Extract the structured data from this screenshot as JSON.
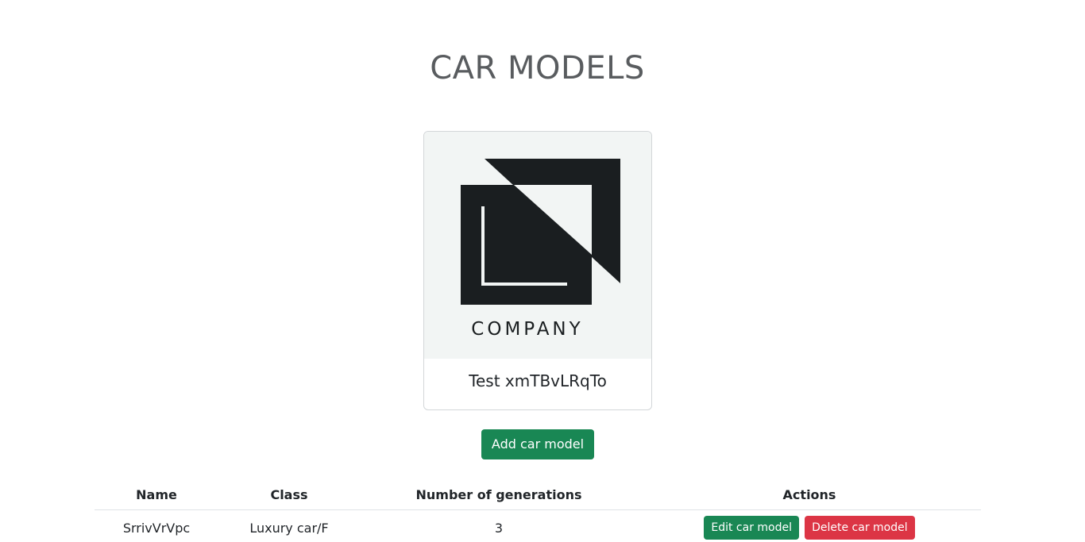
{
  "page": {
    "title": "CAR MODELS"
  },
  "brand": {
    "logo_text": "COMPANY",
    "name": "Test xmTBvLRqTo"
  },
  "actions": {
    "add_label": "Add car model"
  },
  "table": {
    "headers": {
      "name": "Name",
      "class": "Class",
      "generations": "Number of generations",
      "actions": "Actions"
    },
    "rows": [
      {
        "name": "SrrivVrVpc",
        "class": "Luxury car/F",
        "generations": "3",
        "edit_label": "Edit car model",
        "delete_label": "Delete car model"
      }
    ]
  },
  "colors": {
    "primary_green": "#198754",
    "danger_red": "#dc3545",
    "title_gray": "#595c5f",
    "logo_dark": "#1a1e20",
    "logo_bg": "#f2f5f4"
  }
}
